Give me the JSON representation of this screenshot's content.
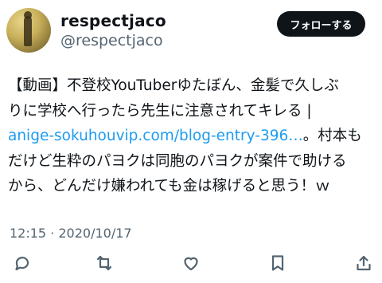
{
  "user": {
    "display_name": "respectjaco",
    "handle": "@respectjaco"
  },
  "follow_button": {
    "label": "フォローする"
  },
  "tweet": {
    "line1": "【動画】不登校YouTuberゆたぼん、金髪で久しぶ",
    "line2": "りに学校へ行ったら先生に注意されてキレる |",
    "link_text": "anige-sokuhouvip.com/blog-entry-396…",
    "line3_after": "。村本も",
    "line4": "だけど生粋のパヨクは同胞のパヨクが案件で助ける",
    "line5": "から、どんだけ嫌われても金は稼げると思う！ｗ"
  },
  "meta": {
    "timestamp": "12:15 · 2020/10/17"
  },
  "actions": [
    "reply-icon",
    "retweet-icon",
    "like-icon",
    "bookmark-icon",
    "share-icon"
  ]
}
